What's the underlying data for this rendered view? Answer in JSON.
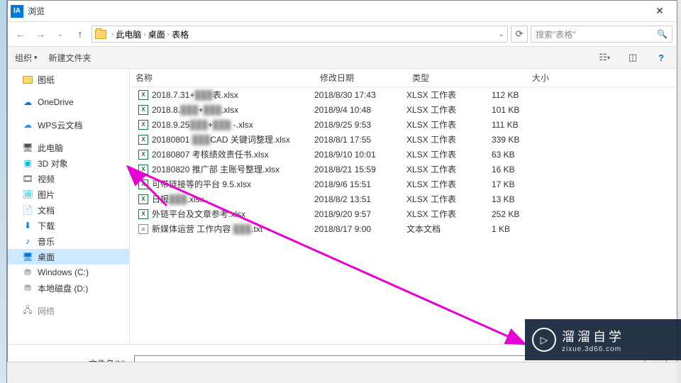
{
  "window": {
    "title": "浏览"
  },
  "breadcrumb": {
    "root": "此电脑",
    "p1": "桌面",
    "p2": "表格"
  },
  "search": {
    "placeholder": "搜索\"表格\""
  },
  "toolbar": {
    "org": "组织",
    "newf": "新建文件夹"
  },
  "cols": {
    "name": "名称",
    "date": "修改日期",
    "type": "类型",
    "size": "大小"
  },
  "sidebar": {
    "paper": "图纸",
    "onedrive": "OneDrive",
    "wps": "WPS云文档",
    "thispc": "此电脑",
    "obj3d": "3D 对象",
    "video": "视频",
    "pic": "图片",
    "doc": "文档",
    "dl": "下载",
    "music": "音乐",
    "desktop": "桌面",
    "c": "Windows (C:)",
    "d": "本地磁盘 (D:)",
    "net": "网络"
  },
  "files": [
    {
      "icon": "x",
      "name": "2018.7.31+███表.xlsx",
      "date": "2018/8/30 17:43",
      "type": "XLSX 工作表",
      "size": "112 KB"
    },
    {
      "icon": "x",
      "name": "2018.8.██+███.xlsx",
      "date": "2018/9/4 10:48",
      "type": "XLSX 工作表",
      "size": "101 KB"
    },
    {
      "icon": "x",
      "name": "2018.9.25███+███ -.xlsx",
      "date": "2018/9/25 9:53",
      "type": "XLSX 工作表",
      "size": "111 KB"
    },
    {
      "icon": "x",
      "name": "20180801 ██CAD 关键词整理.xlsx",
      "date": "2018/8/1 17:55",
      "type": "XLSX 工作表",
      "size": "339 KB"
    },
    {
      "icon": "x",
      "name": "20180807 考核绩效责任书.xlsx",
      "date": "2018/9/10 10:01",
      "type": "XLSX 工作表",
      "size": "63 KB"
    },
    {
      "icon": "x",
      "name": "20180820 推广部 主账号整理.xlsx",
      "date": "2018/8/21 15:59",
      "type": "XLSX 工作表",
      "size": "16 KB"
    },
    {
      "icon": "x",
      "name": "可带链接等的平台 9.5.xlsx",
      "date": "2018/9/6 15:51",
      "type": "XLSX 工作表",
      "size": "17 KB"
    },
    {
      "icon": "x",
      "name": "日报██.xlsx",
      "date": "2018/8/2 13:51",
      "type": "XLSX 工作表",
      "size": "13 KB"
    },
    {
      "icon": "x",
      "name": "外链平台及文章参考.xlsx",
      "date": "2018/9/20 9:57",
      "type": "XLSX 工作表",
      "size": "252 KB"
    },
    {
      "icon": "t",
      "name": "新媒体运营 工作内容 ███.txt",
      "date": "2018/8/17 9:00",
      "type": "文本文档",
      "size": "1 KB"
    }
  ],
  "bottom": {
    "label": "文件名(N):"
  },
  "watermark": {
    "brand": "溜溜自学",
    "url": "zixue.3d66.com"
  }
}
